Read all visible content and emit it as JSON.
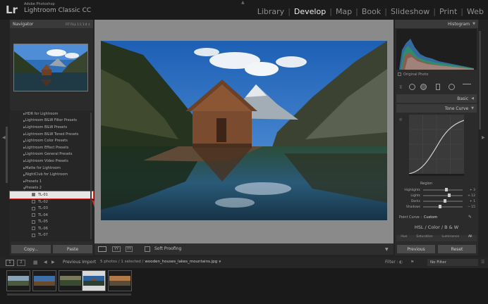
{
  "app": {
    "logo": "Lr",
    "brand_small": "Adobe Photoshop",
    "brand": "Lightroom Classic CC"
  },
  "modules": [
    "Library",
    "Develop",
    "Map",
    "Book",
    "Slideshow",
    "Print",
    "Web"
  ],
  "selected_module": "Develop",
  "left_panel": {
    "navigator_label": "Navigator",
    "nav_zoom": "FIT  FILL  1:1  1:4 ↕",
    "presets": [
      "HDR for Lightroom",
      "Lightroom B&W Filter Presets",
      "Lightroom B&W Presets",
      "Lightroom B&W Toned Presets",
      "Lightroom Color Presets",
      "Lightroom Effect Presets",
      "Lightroom General Presets",
      "Lightroom Video Presets",
      "Matte for Lightroom",
      "NightClub for Lightroom",
      "Presets 1",
      "Presets 2"
    ],
    "sub_presets": [
      "TL-01",
      "TL-02",
      "TL-03",
      "TL-04",
      "TL-05",
      "TL-06",
      "TL-07"
    ],
    "highlighted": "TL-01",
    "copy_label": "Copy...",
    "paste_label": "Paste"
  },
  "toolbar": {
    "soft_proofing": "Soft Proofing"
  },
  "right_panel": {
    "histogram_label": "Histogram",
    "original_photo": "Original Photo",
    "basic_label": "Basic",
    "tone_curve_label": "Tone Curve",
    "region_label": "Region",
    "sliders": [
      {
        "label": "Highlights",
        "value": "+ 3",
        "pos": 0.55
      },
      {
        "label": "Lights",
        "value": "+ 12",
        "pos": 0.62
      },
      {
        "label": "Darks",
        "value": "+ 1",
        "pos": 0.51
      },
      {
        "label": "Shadows",
        "value": "− 15",
        "pos": 0.4
      }
    ],
    "point_curve": "Point Curve :",
    "point_curve_value": "Custom",
    "hsl_label": "HSL  /  Color  /  B & W",
    "hsl_tabs": [
      "Hue",
      "Saturation",
      "Luminance",
      "All"
    ],
    "previous_label": "Previous",
    "reset_label": "Reset"
  },
  "filmstrip": {
    "page1": "1",
    "page2": "2",
    "previous_import": "Previous Import",
    "selection_info": "5 photos / 1 selected /",
    "filename": "wooden_houses_lakes_mountains.jpg",
    "filter_label": "Filter :",
    "filter_value": "No Filter"
  }
}
